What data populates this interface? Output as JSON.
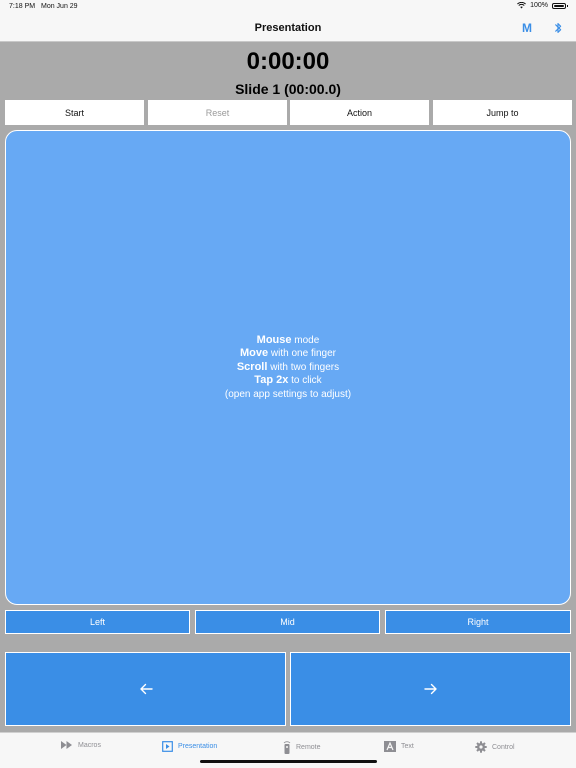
{
  "status": {
    "time": "7:18 PM",
    "date": "Mon Jun 29",
    "battery": "100%"
  },
  "nav": {
    "title": "Presentation",
    "m_label": "M",
    "accent": "#3a8ee6"
  },
  "timer": {
    "elapsed": "0:00:00",
    "slide": "Slide 1 (00:00.0)"
  },
  "controls": {
    "start": "Start",
    "reset": "Reset",
    "action": "Action",
    "jump": "Jump to"
  },
  "pad": {
    "line1_bold": "Mouse",
    "line1_rest": " mode",
    "line2_bold": "Move",
    "line2_rest": " with one finger",
    "line3_bold": "Scroll",
    "line3_rest": " with two fingers",
    "line4_bold": "Tap 2x",
    "line4_rest": " to click",
    "line5": "(open app settings to adjust)"
  },
  "mouse_buttons": {
    "left": "Left",
    "mid": "Mid",
    "right": "Right"
  },
  "arrows": {
    "prev_icon": "arrow-left-icon",
    "next_icon": "arrow-right-icon"
  },
  "tabs": [
    {
      "label": "Macros",
      "icon": "fast-forward-icon"
    },
    {
      "label": "Presentation",
      "icon": "play-square-icon"
    },
    {
      "label": "Remote",
      "icon": "remote-icon"
    },
    {
      "label": "Text",
      "icon": "text-a-icon"
    },
    {
      "label": "Control",
      "icon": "gear-icon"
    }
  ],
  "colors": {
    "pad": "#67a9f4",
    "button_blue": "#3a8ee6",
    "background": "#aaaaaa"
  }
}
